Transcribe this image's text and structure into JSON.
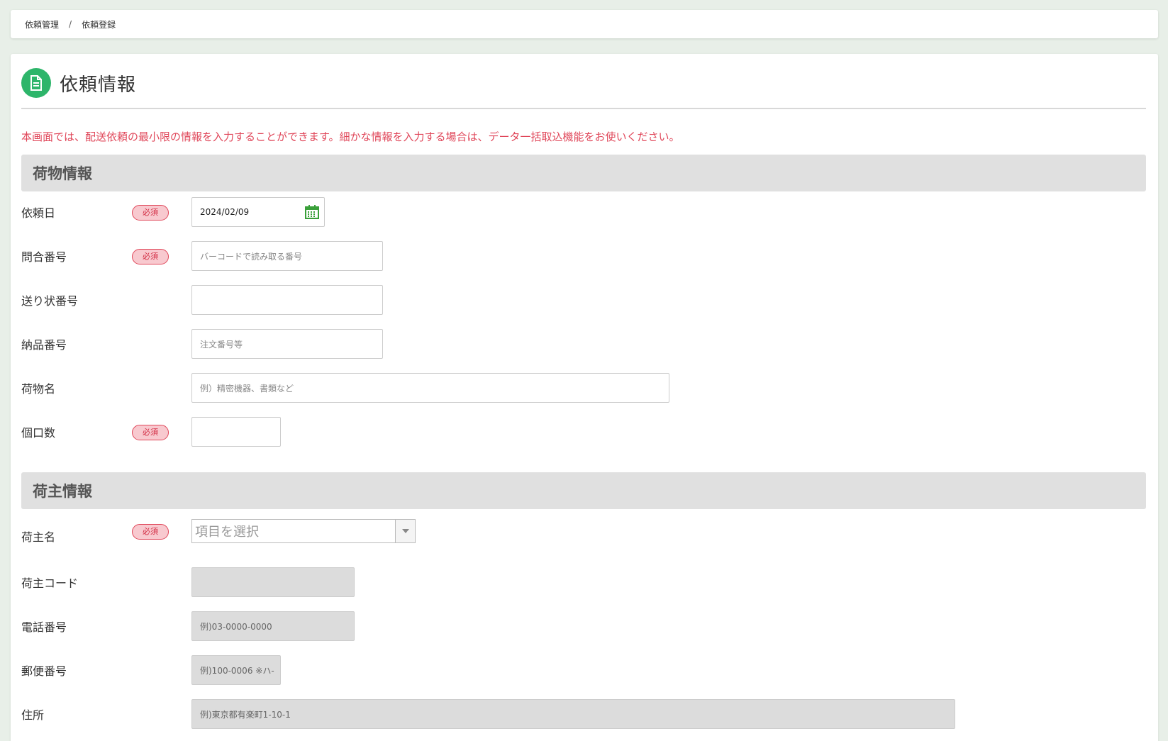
{
  "breadcrumb": {
    "parent": "依頼管理",
    "separator": "/",
    "current": "依頼登録"
  },
  "page": {
    "title": "依頼情報",
    "notice": "本画面では、配送依頼の最小限の情報を入力することができます。細かな情報を入力する場合は、データ一括取込機能をお使いください。"
  },
  "required_label": "必須",
  "sections": {
    "cargo": "荷物情報",
    "shipper": "荷主情報"
  },
  "cargo": {
    "request_date": {
      "label": "依頼日",
      "value": "2024/02/09"
    },
    "inquiry_no": {
      "label": "問合番号",
      "placeholder": "バーコードで読み取る番号"
    },
    "invoice_no": {
      "label": "送り状番号",
      "placeholder": ""
    },
    "delivery_no": {
      "label": "納品番号",
      "placeholder": "注文番号等"
    },
    "item_name": {
      "label": "荷物名",
      "placeholder": "例）精密機器、書類など"
    },
    "pieces": {
      "label": "個口数",
      "placeholder": ""
    }
  },
  "shipper": {
    "name": {
      "label": "荷主名",
      "placeholder": "項目を選択"
    },
    "code": {
      "label": "荷主コード",
      "placeholder": ""
    },
    "phone": {
      "label": "電話番号",
      "placeholder": "例)03-0000-0000"
    },
    "postal": {
      "label": "郵便番号",
      "placeholder": "例)100-0006 ※ハ-"
    },
    "address": {
      "label": "住所",
      "placeholder": "例)東京都有楽町1-10-1"
    }
  },
  "colors": {
    "accent": "#2db56a",
    "required": "#e0475a",
    "notice": "#e0475a"
  },
  "icons": {
    "header": "document-icon",
    "date": "calendar-icon",
    "select": "chevron-down-icon"
  }
}
